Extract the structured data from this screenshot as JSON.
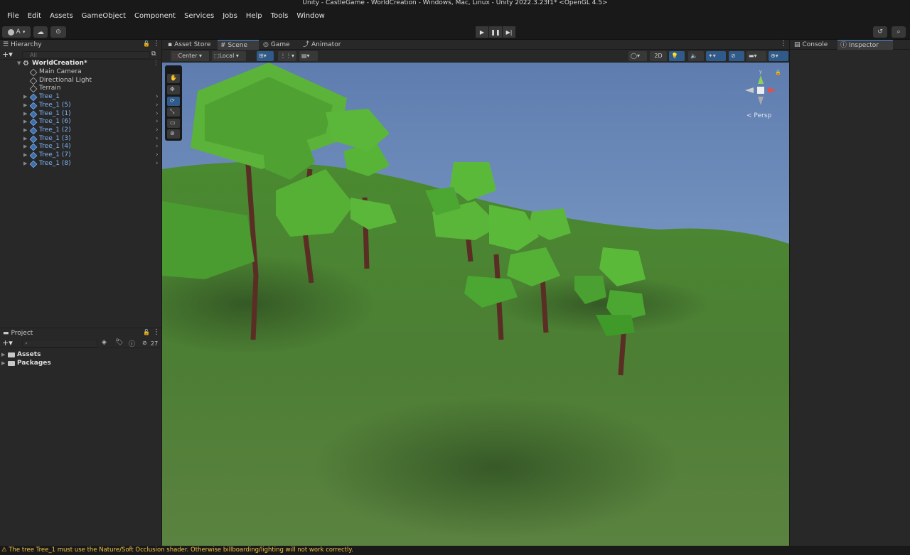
{
  "window": {
    "title": "Unity - CastleGame - WorldCreation - Windows, Mac, Linux - Unity 2022.3.23f1* <OpenGL 4.5>"
  },
  "menu": [
    "File",
    "Edit",
    "Assets",
    "GameObject",
    "Component",
    "Services",
    "Jobs",
    "Help",
    "Tools",
    "Window"
  ],
  "toolbar": {
    "account_label": "A"
  },
  "hierarchy": {
    "tab_label": "Hierarchy",
    "search_placeholder": "All",
    "scene_name": "WorldCreation*",
    "items": [
      {
        "label": "Main Camera",
        "type": "object"
      },
      {
        "label": "Directional Light",
        "type": "object"
      },
      {
        "label": "Terrain",
        "type": "object"
      },
      {
        "label": "Tree_1",
        "type": "prefab"
      },
      {
        "label": "Tree_1 (5)",
        "type": "prefab"
      },
      {
        "label": "Tree_1 (1)",
        "type": "prefab"
      },
      {
        "label": "Tree_1 (6)",
        "type": "prefab"
      },
      {
        "label": "Tree_1 (2)",
        "type": "prefab"
      },
      {
        "label": "Tree_1 (3)",
        "type": "prefab"
      },
      {
        "label": "Tree_1 (4)",
        "type": "prefab"
      },
      {
        "label": "Tree_1 (7)",
        "type": "prefab"
      },
      {
        "label": "Tree_1 (8)",
        "type": "prefab"
      }
    ]
  },
  "project": {
    "tab_label": "Project",
    "hidden_count": "27",
    "folders": [
      "Assets",
      "Packages"
    ]
  },
  "scene_tabs": [
    "Asset Store",
    "Scene",
    "Game",
    "Animator"
  ],
  "scene_toolbar": {
    "pivot": "Center",
    "space": "Local",
    "mode_2d": "2D"
  },
  "gizmo": {
    "projection": "< Persp"
  },
  "right_tabs": [
    "Console",
    "Inspector"
  ],
  "status": {
    "message": "The tree Tree_1 must use the Nature/Soft Occlusion shader. Otherwise billboarding/lighting will not work correctly."
  },
  "colors": {
    "accent": "#4a90e2",
    "prefab_text": "#7fb3f5",
    "warning": "#f0c040",
    "sky": "#6a86b8",
    "grass": "#4a8a34"
  }
}
